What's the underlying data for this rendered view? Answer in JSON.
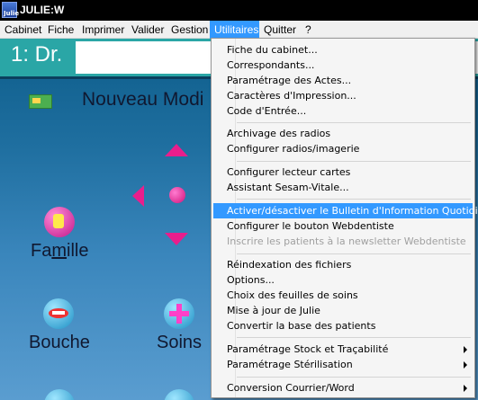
{
  "window": {
    "title": "JULIE:W",
    "icon_label": "Julie"
  },
  "menubar": {
    "items": [
      {
        "label": "Cabinet"
      },
      {
        "label": "Fiche"
      },
      {
        "label": "Imprimer"
      },
      {
        "label": "Valider"
      },
      {
        "label": "Gestion"
      },
      {
        "label": "Utilitaires"
      },
      {
        "label": "Quitter"
      },
      {
        "label": "?"
      }
    ],
    "active": "Utilitaires"
  },
  "main": {
    "header_title": "1: Dr.",
    "nouveau_label": "Nouveau Modi",
    "famille_label_pre": "Fa",
    "famille_label_u": "m",
    "famille_label_post": "ille",
    "bouche_label": "Bouche",
    "soins_label": "Soins"
  },
  "utilitaires_menu": {
    "groups": [
      [
        "Fiche du cabinet...",
        "Correspondants...",
        "Paramétrage des Actes...",
        "Caractères d'Impression...",
        "Code d'Entrée..."
      ],
      [
        "Archivage des radios",
        "Configurer radios/imagerie"
      ],
      [
        "Configurer lecteur cartes",
        "Assistant Sesam-Vitale..."
      ],
      [
        "Activer/désactiver le Bulletin d'Information Quotidien",
        "Configurer le bouton Webdentiste",
        "Inscrire les patients à la newsletter Webdentiste"
      ],
      [
        "Réindexation des fichiers",
        "Options...",
        "Choix des feuilles de soins",
        "Mise à jour de Julie",
        "Convertir la base des patients"
      ],
      [
        "Paramétrage Stock et Traçabilité",
        "Paramétrage Stérilisation"
      ],
      [
        "Conversion Courrier/Word"
      ]
    ],
    "highlighted": "Activer/désactiver le Bulletin d'Information Quotidien",
    "disabled": [
      "Inscrire les patients à la newsletter Webdentiste"
    ],
    "submenus": [
      "Paramétrage Stock et Traçabilité",
      "Paramétrage Stérilisation",
      "Conversion Courrier/Word"
    ]
  },
  "colors": {
    "menu_highlight": "#3399ff",
    "header_strip": "#2aa6a6",
    "accent_pink": "#e91e8c"
  }
}
